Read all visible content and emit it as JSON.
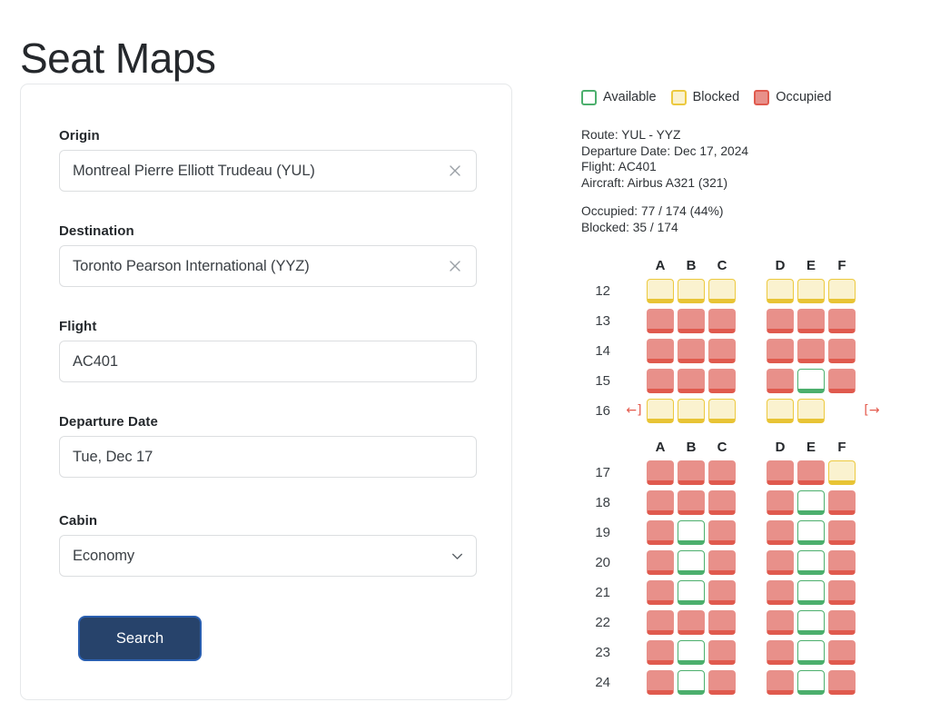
{
  "page": {
    "title": "Seat Maps"
  },
  "search_form": {
    "origin": {
      "label": "Origin",
      "value": "Montreal Pierre Elliott Trudeau (YUL)",
      "placeholder": "Origin",
      "clear_icon": "close-icon"
    },
    "destination": {
      "label": "Destination",
      "value": "Toronto Pearson International (YYZ)",
      "placeholder": "Destination",
      "clear_icon": "close-icon"
    },
    "flight": {
      "label": "Flight",
      "value": "AC401",
      "placeholder": "Flight"
    },
    "departure_date": {
      "label": "Departure Date",
      "value": "Tue, Dec 17",
      "placeholder": "Departure Date"
    },
    "cabin": {
      "label": "Cabin",
      "value": "Economy",
      "chevron_icon": "chevron-down-icon",
      "options": [
        "Economy"
      ]
    },
    "search_button": {
      "label": "Search"
    }
  },
  "legend": {
    "items": [
      {
        "label": "Available",
        "fill": "#ffffff",
        "border": "#4caf6d"
      },
      {
        "label": "Blocked",
        "fill": "#faf2cf",
        "border": "#ecc93f"
      },
      {
        "label": "Occupied",
        "fill": "#e8908a",
        "border": "#e05a4e"
      }
    ]
  },
  "flight_info": {
    "route": "Route: YUL - YYZ",
    "departure_date": "Departure Date: Dec 17, 2024",
    "flight": "Flight: AC401",
    "aircraft": "Aircraft: Airbus A321 (321)",
    "occupied": "Occupied: 77 / 174 (44%)",
    "blocked": "Blocked: 35 / 174"
  },
  "seat_map": {
    "columns_left": [
      "A",
      "B",
      "C"
    ],
    "columns_right": [
      "D",
      "E",
      "F"
    ],
    "exit_icon_left": "←]",
    "exit_icon_right": "[→",
    "sections": [
      {
        "rows": [
          {
            "number": "12",
            "exit": false,
            "left": [
              "blocked",
              "blocked",
              "blocked"
            ],
            "right": [
              "blocked",
              "blocked",
              "blocked"
            ]
          },
          {
            "number": "13",
            "exit": false,
            "left": [
              "occupied",
              "occupied",
              "occupied"
            ],
            "right": [
              "occupied",
              "occupied",
              "occupied"
            ]
          },
          {
            "number": "14",
            "exit": false,
            "left": [
              "occupied",
              "occupied",
              "occupied"
            ],
            "right": [
              "occupied",
              "occupied",
              "occupied"
            ]
          },
          {
            "number": "15",
            "exit": false,
            "left": [
              "occupied",
              "occupied",
              "occupied"
            ],
            "right": [
              "occupied",
              "available",
              "occupied"
            ]
          },
          {
            "number": "16",
            "exit": true,
            "left": [
              "blocked",
              "blocked",
              "blocked"
            ],
            "right": [
              "blocked",
              "blocked",
              "empty"
            ]
          }
        ]
      },
      {
        "rows": [
          {
            "number": "17",
            "exit": false,
            "left": [
              "occupied",
              "occupied",
              "occupied"
            ],
            "right": [
              "occupied",
              "occupied",
              "blocked"
            ]
          },
          {
            "number": "18",
            "exit": false,
            "left": [
              "occupied",
              "occupied",
              "occupied"
            ],
            "right": [
              "occupied",
              "available",
              "occupied"
            ]
          },
          {
            "number": "19",
            "exit": false,
            "left": [
              "occupied",
              "available",
              "occupied"
            ],
            "right": [
              "occupied",
              "available",
              "occupied"
            ]
          },
          {
            "number": "20",
            "exit": false,
            "left": [
              "occupied",
              "available",
              "occupied"
            ],
            "right": [
              "occupied",
              "available",
              "occupied"
            ]
          },
          {
            "number": "21",
            "exit": false,
            "left": [
              "occupied",
              "available",
              "occupied"
            ],
            "right": [
              "occupied",
              "available",
              "occupied"
            ]
          },
          {
            "number": "22",
            "exit": false,
            "left": [
              "occupied",
              "occupied",
              "occupied"
            ],
            "right": [
              "occupied",
              "available",
              "occupied"
            ]
          },
          {
            "number": "23",
            "exit": false,
            "left": [
              "occupied",
              "available",
              "occupied"
            ],
            "right": [
              "occupied",
              "available",
              "occupied"
            ]
          },
          {
            "number": "24",
            "exit": false,
            "left": [
              "occupied",
              "available",
              "occupied"
            ],
            "right": [
              "occupied",
              "available",
              "occupied"
            ]
          }
        ]
      }
    ]
  }
}
